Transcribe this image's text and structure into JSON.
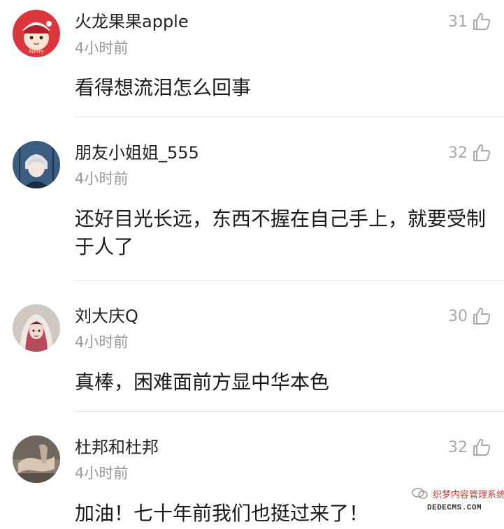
{
  "comments": [
    {
      "username": "火龙果果apple",
      "time": "4小时前",
      "likes": "31",
      "text": "看得想流泪怎么回事",
      "avatar_icon": "christmas-girl-avatar-icon"
    },
    {
      "username": "朋友小姐姐_555",
      "time": "4小时前",
      "likes": "32",
      "text": "还好目光长远，东西不握在自己手上，就要受制于人了",
      "avatar_icon": "anime-boy-avatar-icon"
    },
    {
      "username": "刘大庆Q",
      "time": "4小时前",
      "likes": "30",
      "text": "真棒，困难面前方显中华本色",
      "avatar_icon": "veiled-woman-avatar-icon"
    },
    {
      "username": "杜邦和杜邦",
      "time": "4小时前",
      "likes": "32",
      "text": "加油！七十年前我们也挺过来了！",
      "avatar_icon": "photo-avatar-icon"
    }
  ],
  "watermark": {
    "line1": "织梦内容管理系统",
    "line2": "DEDECMS.COM"
  },
  "colors": {
    "username": "#222222",
    "time": "#9a9a9a",
    "like": "#a8a8a8",
    "divider": "#e3e3e3"
  }
}
